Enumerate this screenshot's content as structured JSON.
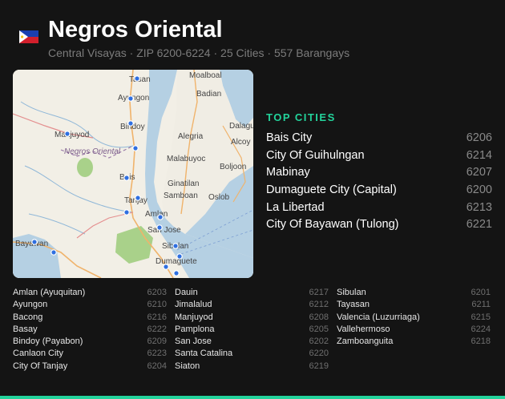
{
  "header": {
    "title": "Negros Oriental",
    "subtitle": "Central Visayas · ZIP 6200-6224 · 25 Cities · 557 Barangays",
    "flag_icon": "philippines-flag-icon"
  },
  "map": {
    "labels": {
      "tasan": "Tasan",
      "moalboal": "Moalboal",
      "ayungon": "Ayungon",
      "badian": "Badian",
      "bindoy": "Bindoy",
      "dalaguete": "Dalagu",
      "manjuyod": "Manjuyod",
      "alegria": "Alegria",
      "alcoy": "Alcoy",
      "negros_oriental": "Negros Oriental",
      "malabuyoc": "Malabuyoc",
      "boljoon": "Boljoon",
      "bais": "Bais",
      "ginatilan": "Ginatilan",
      "samboan": "Samboan",
      "tanjay": "Tanjay",
      "oslob": "Oslob",
      "amlan": "Amlan",
      "san_jose": "San Jose",
      "bayawan": "Bayawan",
      "sibulan": "Sibulan",
      "dumaguete": "Dumaguete"
    },
    "colors": {
      "water": "#b5d0e3",
      "land": "#f2efe6",
      "marker": "#2f6fe0",
      "park": "#a9d18a"
    }
  },
  "top_cities": {
    "heading": "TOP CITIES",
    "items": [
      {
        "name": "Bais City",
        "zip": "6206"
      },
      {
        "name": "City Of Guihulngan",
        "zip": "6214"
      },
      {
        "name": "Mabinay",
        "zip": "6207"
      },
      {
        "name": "Dumaguete City (Capital)",
        "zip": "6200"
      },
      {
        "name": "La Libertad",
        "zip": "6213"
      },
      {
        "name": "City Of Bayawan (Tulong)",
        "zip": "6221"
      }
    ]
  },
  "cities": [
    [
      {
        "name": "Amlan (Ayuquitan)",
        "zip": "6203"
      },
      {
        "name": "Ayungon",
        "zip": "6210"
      },
      {
        "name": "Bacong",
        "zip": "6216"
      },
      {
        "name": "Basay",
        "zip": "6222"
      },
      {
        "name": "Bindoy (Payabon)",
        "zip": "6209"
      },
      {
        "name": "Canlaon City",
        "zip": "6223"
      },
      {
        "name": "City Of Tanjay",
        "zip": "6204"
      }
    ],
    [
      {
        "name": "Dauin",
        "zip": "6217"
      },
      {
        "name": "Jimalalud",
        "zip": "6212"
      },
      {
        "name": "Manjuyod",
        "zip": "6208"
      },
      {
        "name": "Pamplona",
        "zip": "6205"
      },
      {
        "name": "San Jose",
        "zip": "6202"
      },
      {
        "name": "Santa Catalina",
        "zip": "6220"
      },
      {
        "name": "Siaton",
        "zip": "6219"
      }
    ],
    [
      {
        "name": "Sibulan",
        "zip": "6201"
      },
      {
        "name": "Tayasan",
        "zip": "6211"
      },
      {
        "name": "Valencia (Luzurriaga)",
        "zip": "6215"
      },
      {
        "name": "Vallehermoso",
        "zip": "6224"
      },
      {
        "name": "Zamboanguita",
        "zip": "6218"
      }
    ]
  ],
  "accent_color": "#23d39b"
}
